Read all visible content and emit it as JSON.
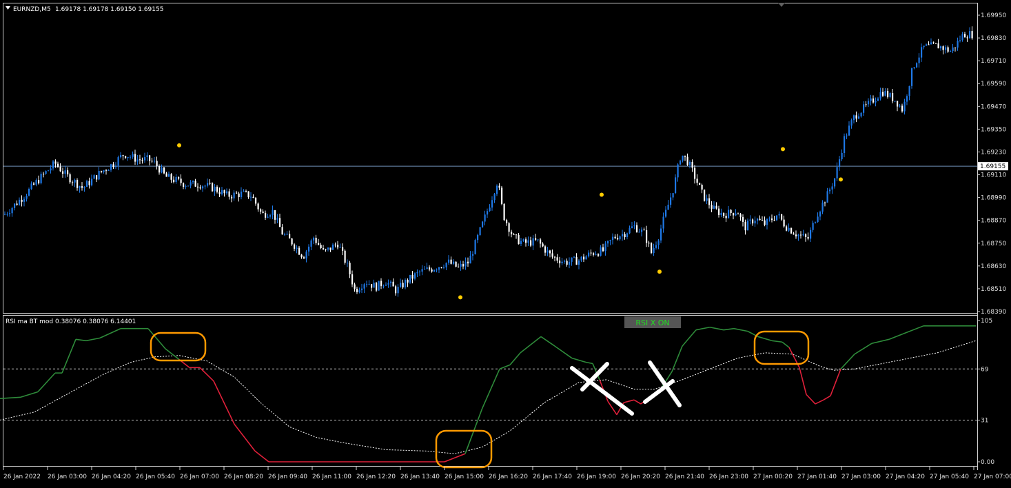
{
  "header": {
    "symbol": "EURNZD,M5",
    "ohlc": "1.69178 1.69178 1.69150 1.69155",
    "collapse_icon": "triangle-down-icon"
  },
  "indicator": {
    "title": "RSI ma BT mod 0.38076 0.38076 6.14401",
    "status_badge": "RSI X ON",
    "colors": {
      "rsi_up": "#2e8b3a",
      "rsi_down": "#e0203a",
      "signal": "#ffffff",
      "badge_bg": "#555555",
      "badge_text": "#22dd22"
    }
  },
  "colors": {
    "background": "#000000",
    "bull_candle": "#1e78e6",
    "bear_candle": "#ffffff",
    "price_line": "#7090b8",
    "marker_dot": "#ffcc00",
    "highlight_box": "#ff9900",
    "cross_mark": "#ffffff"
  },
  "chart_data": [
    {
      "type": "candlestick",
      "symbol": "EURNZD,M5",
      "ylim": [
        1.6839,
        1.6995
      ],
      "y_ticks": [
        "1.69950",
        "1.69830",
        "1.69710",
        "1.69590",
        "1.69470",
        "1.69350",
        "1.69230",
        "1.69110",
        "1.68990",
        "1.68870",
        "1.68750",
        "1.68630",
        "1.68510",
        "1.68390"
      ],
      "current_price": "1.69155",
      "price_path": [
        [
          0,
          1.6888
        ],
        [
          15,
          1.6893
        ],
        [
          35,
          1.69
        ],
        [
          60,
          1.691
        ],
        [
          80,
          1.6917
        ],
        [
          95,
          1.6911
        ],
        [
          120,
          1.6904
        ],
        [
          145,
          1.6912
        ],
        [
          165,
          1.6917
        ],
        [
          180,
          1.6922
        ],
        [
          200,
          1.6919
        ],
        [
          215,
          1.6919
        ],
        [
          225,
          1.6917
        ],
        [
          240,
          1.691
        ],
        [
          255,
          1.6908
        ],
        [
          270,
          1.6906
        ],
        [
          290,
          1.6906
        ],
        [
          310,
          1.6904
        ],
        [
          330,
          1.69
        ],
        [
          350,
          1.6901
        ],
        [
          365,
          1.69
        ],
        [
          380,
          1.689
        ],
        [
          395,
          1.6892
        ],
        [
          410,
          1.688
        ],
        [
          425,
          1.6875
        ],
        [
          440,
          1.6868
        ],
        [
          455,
          1.6878
        ],
        [
          470,
          1.687
        ],
        [
          490,
          1.6875
        ],
        [
          505,
          1.6862
        ],
        [
          515,
          1.685
        ],
        [
          530,
          1.6855
        ],
        [
          545,
          1.6852
        ],
        [
          560,
          1.6855
        ],
        [
          575,
          1.685
        ],
        [
          590,
          1.6855
        ],
        [
          610,
          1.686
        ],
        [
          630,
          1.6862
        ],
        [
          650,
          1.6865
        ],
        [
          665,
          1.6862
        ],
        [
          680,
          1.6865
        ],
        [
          695,
          1.688
        ],
        [
          710,
          1.6895
        ],
        [
          722,
          1.6908
        ],
        [
          730,
          1.689
        ],
        [
          745,
          1.6878
        ],
        [
          760,
          1.6875
        ],
        [
          780,
          1.6876
        ],
        [
          800,
          1.6868
        ],
        [
          820,
          1.6865
        ],
        [
          840,
          1.6866
        ],
        [
          860,
          1.687
        ],
        [
          875,
          1.6871
        ],
        [
          890,
          1.6878
        ],
        [
          905,
          1.688
        ],
        [
          920,
          1.6884
        ],
        [
          935,
          1.688
        ],
        [
          945,
          1.687
        ],
        [
          955,
          1.6878
        ],
        [
          965,
          1.689
        ],
        [
          978,
          1.6905
        ],
        [
          988,
          1.6922
        ],
        [
          998,
          1.6918
        ],
        [
          1008,
          1.691
        ],
        [
          1020,
          1.69
        ],
        [
          1035,
          1.6893
        ],
        [
          1050,
          1.689
        ],
        [
          1070,
          1.6892
        ],
        [
          1080,
          1.6883
        ],
        [
          1095,
          1.6888
        ],
        [
          1110,
          1.6885
        ],
        [
          1128,
          1.689
        ],
        [
          1140,
          1.6884
        ],
        [
          1155,
          1.688
        ],
        [
          1172,
          1.6877
        ],
        [
          1185,
          1.689
        ],
        [
          1200,
          1.69
        ],
        [
          1212,
          1.691
        ],
        [
          1225,
          1.693
        ],
        [
          1240,
          1.6942
        ],
        [
          1260,
          1.6948
        ],
        [
          1280,
          1.6955
        ],
        [
          1300,
          1.695
        ],
        [
          1310,
          1.6945
        ],
        [
          1325,
          1.6968
        ],
        [
          1340,
          1.6978
        ],
        [
          1360,
          1.6979
        ],
        [
          1380,
          1.6976
        ],
        [
          1398,
          1.6985
        ],
        [
          1412,
          1.6985
        ]
      ],
      "markers": [
        [
          260,
          1.69265
        ],
        [
          668,
          1.68465
        ],
        [
          873,
          1.69005
        ],
        [
          957,
          1.686
        ],
        [
          1136,
          1.69245
        ],
        [
          1220,
          1.69085
        ]
      ]
    },
    {
      "type": "line",
      "title": "RSI ma BT mod 0.38076 0.38076 6.14401",
      "ylim": [
        0,
        105
      ],
      "y_ticks": [
        "105",
        "69",
        "31",
        "0.00"
      ],
      "levels": [
        69,
        31
      ],
      "series": [
        {
          "name": "RSI",
          "values": [
            [
              0,
              47
            ],
            [
              30,
              48
            ],
            [
              55,
              52
            ],
            [
              80,
              66
            ],
            [
              90,
              66
            ],
            [
              110,
              91
            ],
            [
              125,
              90
            ],
            [
              145,
              92
            ],
            [
              175,
              99
            ],
            [
              215,
              99
            ],
            [
              240,
              84
            ],
            [
              260,
              76
            ],
            [
              275,
              70
            ],
            [
              290,
              70
            ],
            [
              310,
              60
            ],
            [
              340,
              28
            ],
            [
              370,
              8
            ],
            [
              390,
              0
            ],
            [
              450,
              0
            ],
            [
              550,
              0
            ],
            [
              645,
              0
            ],
            [
              675,
              6
            ],
            [
              700,
              40
            ],
            [
              725,
              69
            ],
            [
              740,
              72
            ],
            [
              755,
              81
            ],
            [
              785,
              93
            ],
            [
              805,
              86
            ],
            [
              830,
              77
            ],
            [
              850,
              74
            ],
            [
              860,
              73
            ],
            [
              870,
              61
            ],
            [
              882,
              45
            ],
            [
              895,
              35
            ],
            [
              905,
              44
            ],
            [
              920,
              46
            ],
            [
              930,
              43
            ],
            [
              945,
              49
            ],
            [
              960,
              55
            ],
            [
              975,
              67
            ],
            [
              990,
              86
            ],
            [
              1010,
              98
            ],
            [
              1030,
              100
            ],
            [
              1050,
              98
            ],
            [
              1065,
              99
            ],
            [
              1085,
              97
            ],
            [
              1100,
              93
            ],
            [
              1120,
              90
            ],
            [
              1135,
              89
            ],
            [
              1145,
              85
            ],
            [
              1160,
              70
            ],
            [
              1170,
              50
            ],
            [
              1183,
              43
            ],
            [
              1195,
              46
            ],
            [
              1205,
              49
            ],
            [
              1220,
              69
            ],
            [
              1240,
              80
            ],
            [
              1265,
              88
            ],
            [
              1290,
              91
            ],
            [
              1310,
              95
            ],
            [
              1340,
              101
            ],
            [
              1416,
              101
            ]
          ]
        },
        {
          "name": "Signal",
          "values": [
            [
              0,
              31
            ],
            [
              50,
              37
            ],
            [
              100,
              51
            ],
            [
              150,
              65
            ],
            [
              190,
              74
            ],
            [
              225,
              78
            ],
            [
              260,
              79
            ],
            [
              300,
              75
            ],
            [
              340,
              63
            ],
            [
              380,
              43
            ],
            [
              420,
              26
            ],
            [
              460,
              18
            ],
            [
              500,
              14
            ],
            [
              560,
              9
            ],
            [
              620,
              8
            ],
            [
              660,
              6
            ],
            [
              700,
              11
            ],
            [
              740,
              23
            ],
            [
              790,
              44
            ],
            [
              840,
              59
            ],
            [
              880,
              61
            ],
            [
              920,
              54
            ],
            [
              950,
              54
            ],
            [
              990,
              61
            ],
            [
              1030,
              69
            ],
            [
              1070,
              77
            ],
            [
              1110,
              81
            ],
            [
              1150,
              80
            ],
            [
              1190,
              71
            ],
            [
              1210,
              68
            ],
            [
              1240,
              69
            ],
            [
              1300,
              75
            ],
            [
              1360,
              81
            ],
            [
              1416,
              90
            ]
          ]
        }
      ]
    }
  ],
  "time_axis": {
    "labels": [
      "26 Jan 2022",
      "26 Jan 03:00",
      "26 Jan 04:20",
      "26 Jan 05:40",
      "26 Jan 07:00",
      "26 Jan 08:20",
      "26 Jan 09:40",
      "26 Jan 11:00",
      "26 Jan 12:20",
      "26 Jan 13:40",
      "26 Jan 15:00",
      "26 Jan 16:20",
      "26 Jan 17:40",
      "26 Jan 19:00",
      "26 Jan 20:20",
      "26 Jan 21:40",
      "26 Jan 23:00",
      "27 Jan 00:20",
      "27 Jan 01:40",
      "27 Jan 03:00",
      "27 Jan 04:20",
      "27 Jan 05:40",
      "27 Jan 07:00"
    ]
  }
}
